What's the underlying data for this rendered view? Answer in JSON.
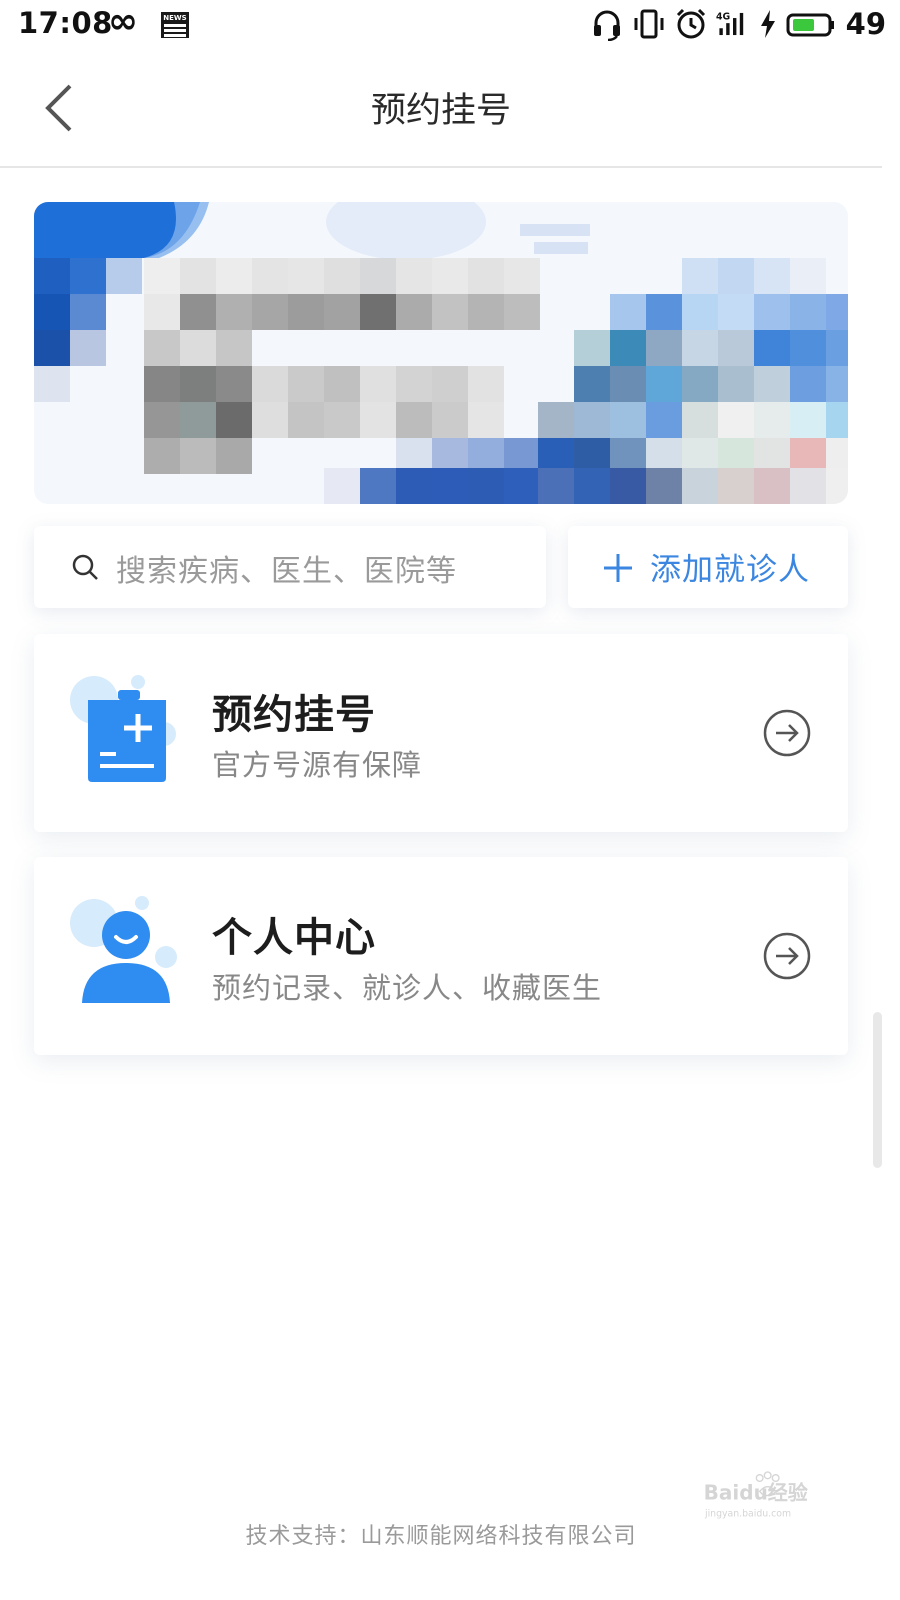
{
  "status_bar": {
    "time": "17:08",
    "infinity_symbol": "∞",
    "news_badge": "NEWS",
    "network_label": "4G",
    "battery_level": "49",
    "icons": [
      "headset-icon",
      "vibrate-icon",
      "alarm-icon",
      "signal-icon",
      "charging-icon",
      "battery-icon"
    ]
  },
  "nav": {
    "title": "预约挂号",
    "back_icon": "chevron-left-icon"
  },
  "search": {
    "placeholder": "搜索疾病、医生、医院等"
  },
  "add_patient": {
    "label": "添加就诊人"
  },
  "cards": [
    {
      "title": "预约挂号",
      "subtitle": "官方号源有保障",
      "icon": "clipboard-plus-icon"
    },
    {
      "title": "个人中心",
      "subtitle": "预约记录、就诊人、收藏医生",
      "icon": "user-avatar-icon"
    }
  ],
  "footer": {
    "text": "技术支持：山东顺能网络科技有限公司"
  },
  "colors": {
    "accent": "#3b86e0",
    "icon_blue": "#2f8cf0",
    "icon_blue_light": "#cfe6fb",
    "text_dark": "#1d1d1d",
    "text_gray": "#888888",
    "divider": "#e6e6e6",
    "battery_green": "#3cc83c"
  },
  "watermark": {
    "brand": "Baidu经验",
    "url": "jingyan.baidu.com"
  }
}
